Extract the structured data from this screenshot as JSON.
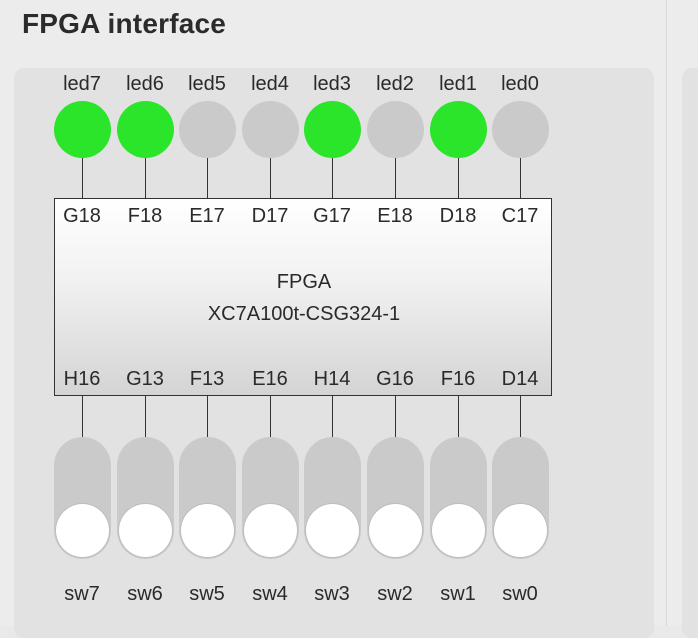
{
  "title": "FPGA interface",
  "chip": {
    "name": "FPGA",
    "part": "XC7A100t-CSG324-1"
  },
  "leds": [
    {
      "label": "led7",
      "pin": "G18",
      "on": true
    },
    {
      "label": "led6",
      "pin": "F18",
      "on": true
    },
    {
      "label": "led5",
      "pin": "E17",
      "on": false
    },
    {
      "label": "led4",
      "pin": "D17",
      "on": false
    },
    {
      "label": "led3",
      "pin": "G17",
      "on": true
    },
    {
      "label": "led2",
      "pin": "E18",
      "on": false
    },
    {
      "label": "led1",
      "pin": "D18",
      "on": true
    },
    {
      "label": "led0",
      "pin": "C17",
      "on": false
    }
  ],
  "switches": [
    {
      "label": "sw7",
      "pin": "H16",
      "on": false
    },
    {
      "label": "sw6",
      "pin": "G13",
      "on": false
    },
    {
      "label": "sw5",
      "pin": "F13",
      "on": false
    },
    {
      "label": "sw4",
      "pin": "E16",
      "on": false
    },
    {
      "label": "sw3",
      "pin": "H14",
      "on": false
    },
    {
      "label": "sw2",
      "pin": "G16",
      "on": false
    },
    {
      "label": "sw1",
      "pin": "F16",
      "on": false
    },
    {
      "label": "sw0",
      "pin": "D14",
      "on": false
    }
  ],
  "colors": {
    "led_on": "#2ae52a",
    "led_off": "#cacaca",
    "switch_track": "#cacaca",
    "switch_knob": "#ffffff"
  }
}
